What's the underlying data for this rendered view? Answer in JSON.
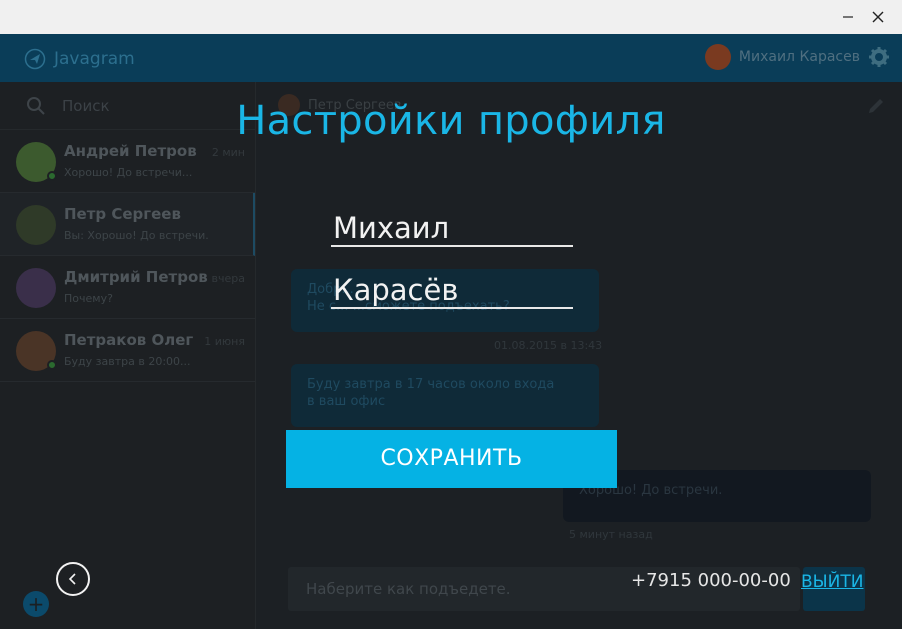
{
  "window": {
    "minimize_icon": "minimize-icon",
    "close_icon": "close-icon"
  },
  "app": {
    "name": "Javagram",
    "user_name": "Михаил Карасев"
  },
  "sidebar": {
    "search_placeholder": "Поиск",
    "chats": [
      {
        "name": "Андрей Петров",
        "time": "2 мин",
        "preview": "Хорошо! До встречи...",
        "online": true
      },
      {
        "name": "Петр Сергеев",
        "time": "",
        "preview": "Вы: Хорошо! До встречи.",
        "online": false
      },
      {
        "name": "Дмитрий Петров",
        "time": "вчера",
        "preview": "Почему?",
        "online": false
      },
      {
        "name": "Петраков Олег",
        "time": "1 июня",
        "preview": "Буду завтра в 20:00...",
        "online": true
      }
    ]
  },
  "chat": {
    "contact_name": "Петр Сергеев",
    "messages": [
      {
        "text_1": "Добр...",
        "text_2": "Не с... ...сможете подъехать?",
        "time": "01.08.2015 в 13:43"
      },
      {
        "text_1": "Буду завтра в 17 часов около входа",
        "text_2": "в ваш офис",
        "time": ""
      },
      {
        "text_1": "Хорошо! До встречи.",
        "time": "5 минут назад"
      }
    ],
    "composer_placeholder": "Наберите как подъедете."
  },
  "profile": {
    "title": "Настройки профиля",
    "first_name": "Михаил",
    "last_name": "Карасёв",
    "save_label": "СОХРАНИТЬ",
    "phone": "+7915 000-00-00",
    "logout_label": "ВЫЙТИ"
  }
}
